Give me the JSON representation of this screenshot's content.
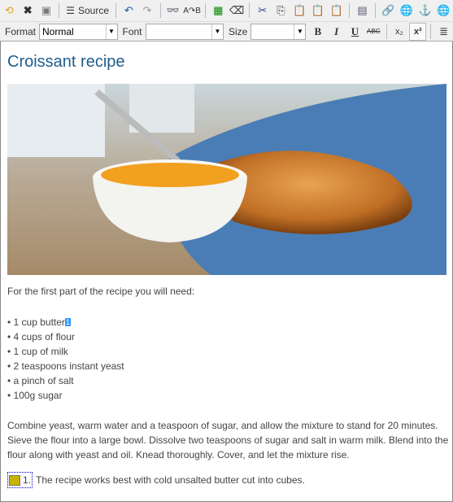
{
  "toolbar": {
    "source_label": "Source",
    "format_label": "Format",
    "format_value": "Normal",
    "font_label": "Font",
    "font_value": "",
    "size_label": "Size",
    "size_value": "",
    "bold": "B",
    "italic": "I",
    "underline": "U",
    "strike": "ABC",
    "subscript": "x₂",
    "superscript": "x²"
  },
  "content": {
    "title": "Croissant recipe",
    "intro": "For the first part of the recipe you will need:",
    "ingredients": [
      "• 1 cup butter",
      "• 4 cups of flour",
      "• 1 cup of milk",
      "• 2 teaspoons instant yeast",
      "• a pinch of salt",
      "• 100g sugar"
    ],
    "footnote_marker": "1",
    "paragraph": "Combine yeast, warm water and a teaspoon of sugar, and allow the mixture to stand for 20 minutes. Sieve the flour into a large bowl. Dissolve two teaspoons of sugar and salt in warm milk. Blend into the flour along with yeast and oil. Knead thoroughly. Cover, and let the mixture rise.",
    "footnote_number": "1.",
    "footnote_text": "The recipe works best with cold unsalted butter cut into cubes."
  },
  "colors": {
    "title": "#1e5d8c",
    "highlight": "#3399ff"
  }
}
